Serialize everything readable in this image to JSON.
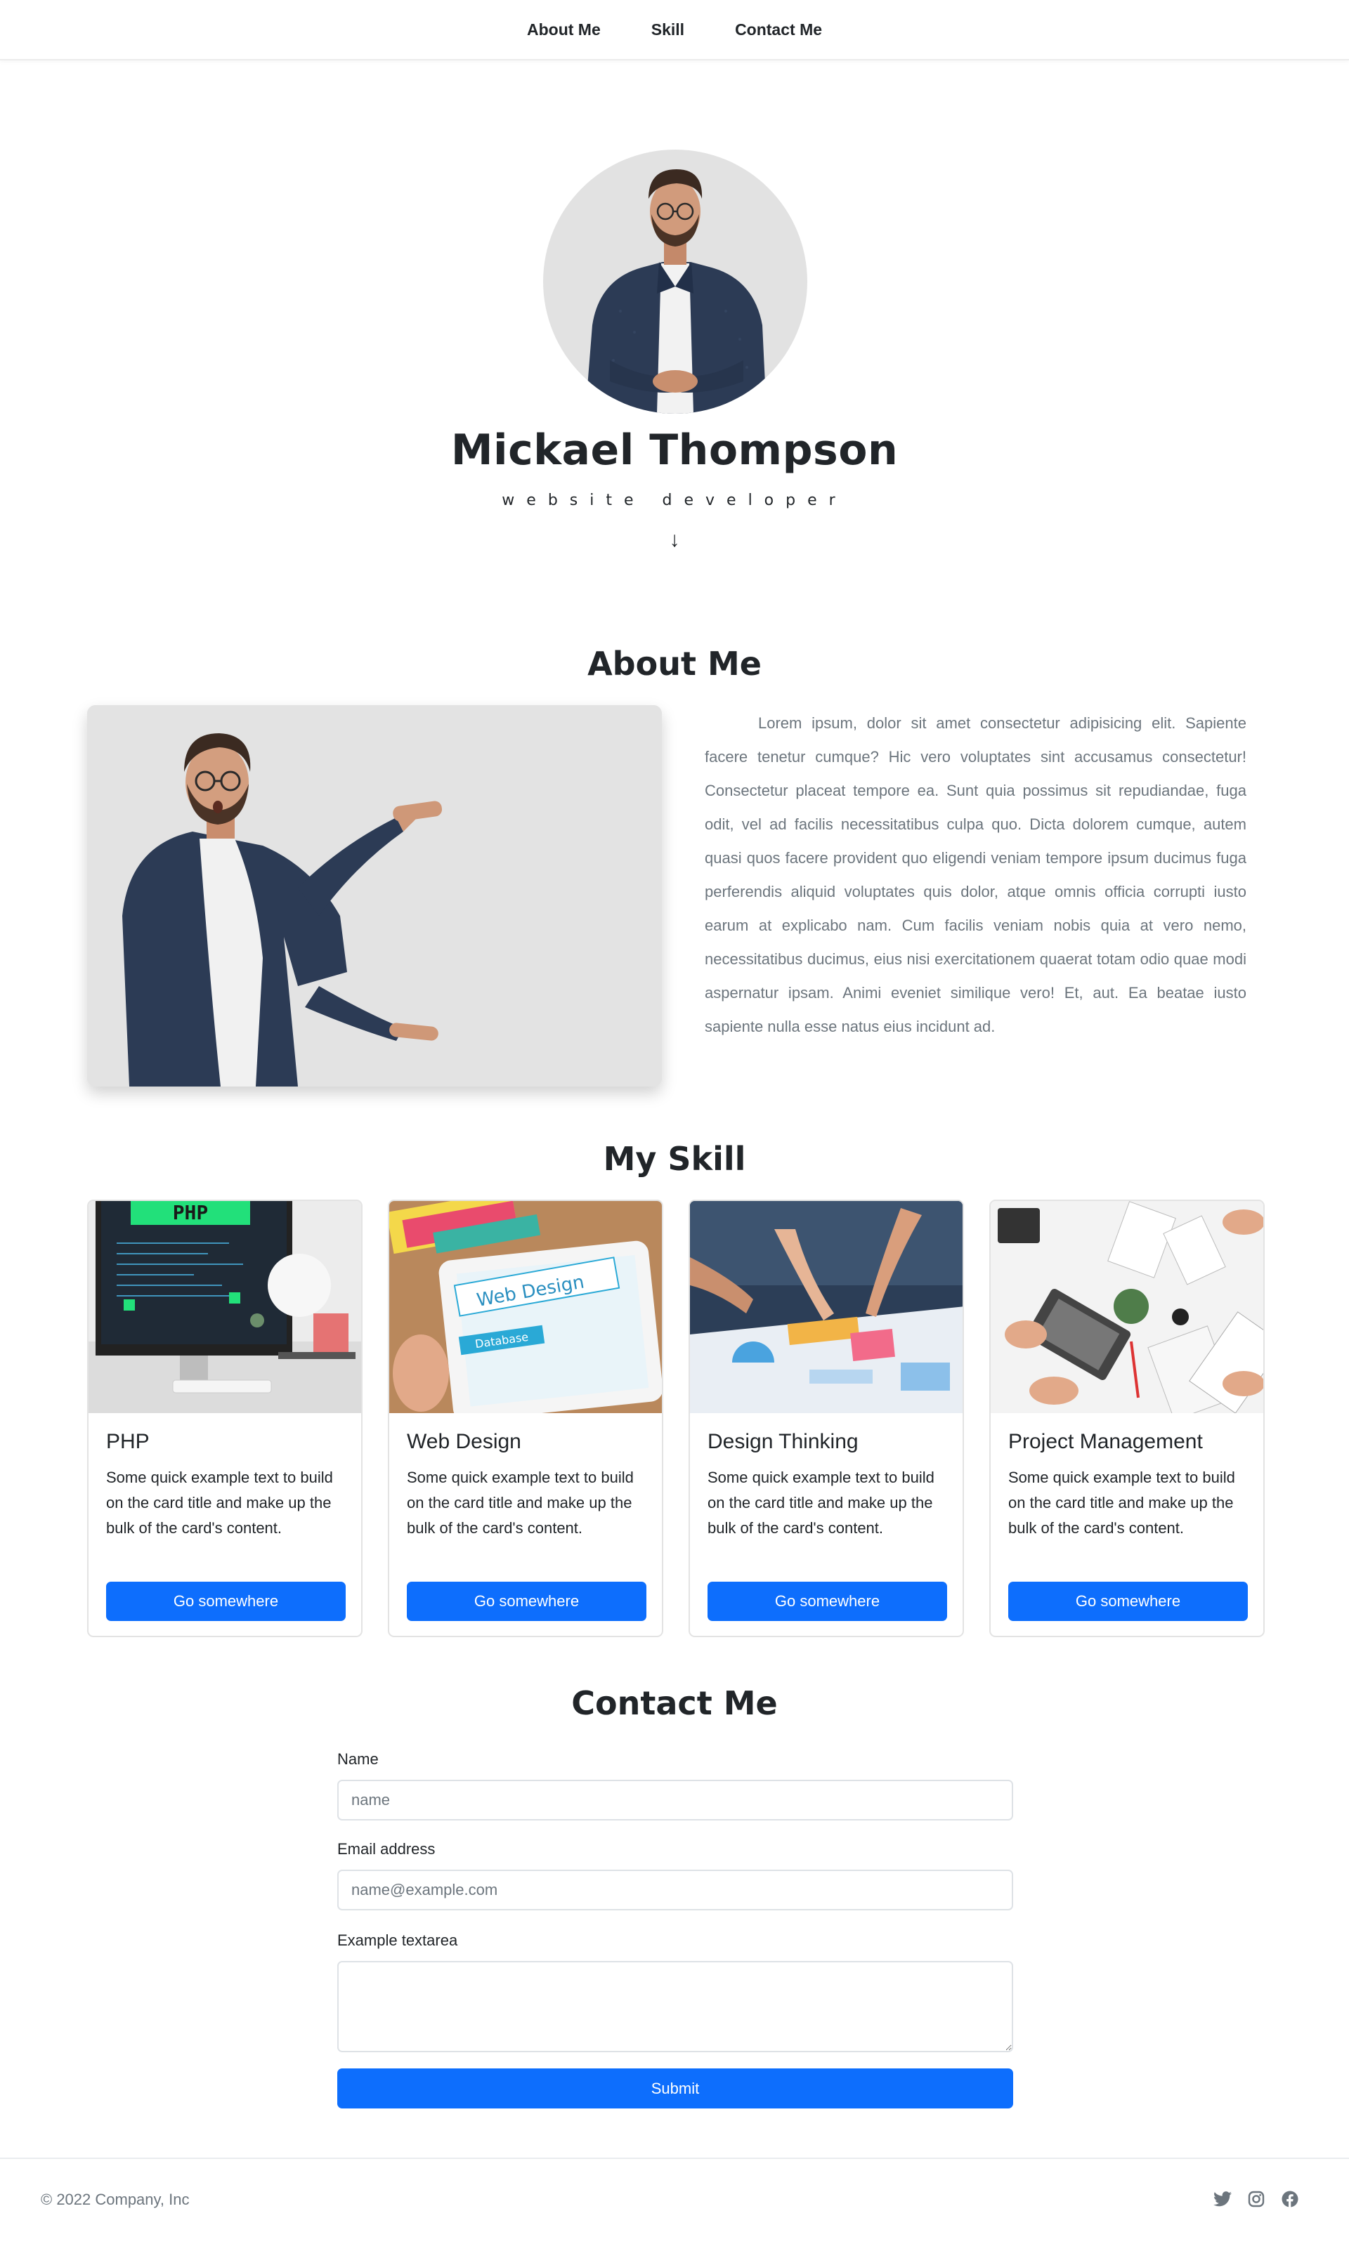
{
  "nav": {
    "items": [
      {
        "label": "About Me"
      },
      {
        "label": "Skill"
      },
      {
        "label": "Contact Me"
      }
    ]
  },
  "hero": {
    "name": "Mickael Thompson",
    "role": "website developer",
    "arrow": "↓"
  },
  "about": {
    "title": "About Me",
    "text": "Lorem ipsum, dolor sit amet consectetur adipisicing elit. Sapiente facere tenetur cumque? Hic vero voluptates sint accusamus consectetur! Consectetur placeat tempore ea. Sunt quia possimus sit repudiandae, fuga odit, vel ad facilis necessitatibus culpa quo. Dicta dolorem cumque, autem quasi quos facere provident quo eligendi veniam tempore ipsum ducimus fuga perferendis aliquid voluptates quis dolor, atque omnis officia corrupti iusto earum at explicabo nam. Cum facilis veniam nobis quia at vero nemo, necessitatibus ducimus, eius nisi exercitationem quaerat totam odio quae modi aspernatur ipsam. Animi eveniet similique vero! Et, aut. Ea beatae iusto sapiente nulla esse natus eius incidunt ad."
  },
  "skills": {
    "title": "My Skill",
    "cards": [
      {
        "title": "PHP",
        "text": "Some quick example text to build on the card title and make up the bulk of the card's content.",
        "button": "Go somewhere"
      },
      {
        "title": "Web Design",
        "text": "Some quick example text to build on the card title and make up the bulk of the card's content.",
        "button": "Go somewhere"
      },
      {
        "title": "Design Thinking",
        "text": "Some quick example text to build on the card title and make up the bulk of the card's content.",
        "button": "Go somewhere"
      },
      {
        "title": "Project Management",
        "text": "Some quick example text to build on the card title and make up the bulk of the card's content.",
        "button": "Go somewhere"
      }
    ],
    "image_text": {
      "php_banner": "PHP",
      "web_design": "Web Design",
      "database": "Database"
    }
  },
  "contact": {
    "title": "Contact Me",
    "name_label": "Name",
    "name_placeholder": "name",
    "email_label": "Email address",
    "email_placeholder": "name@example.com",
    "textarea_label": "Example textarea",
    "submit": "Submit"
  },
  "footer": {
    "copyright": "© 2022 Company, Inc",
    "social": [
      "twitter-icon",
      "instagram-icon",
      "facebook-icon"
    ]
  },
  "colors": {
    "primary": "#0d6efd",
    "text": "#212529",
    "muted": "#6c757d",
    "photo_bg": "#e3e3e3"
  }
}
